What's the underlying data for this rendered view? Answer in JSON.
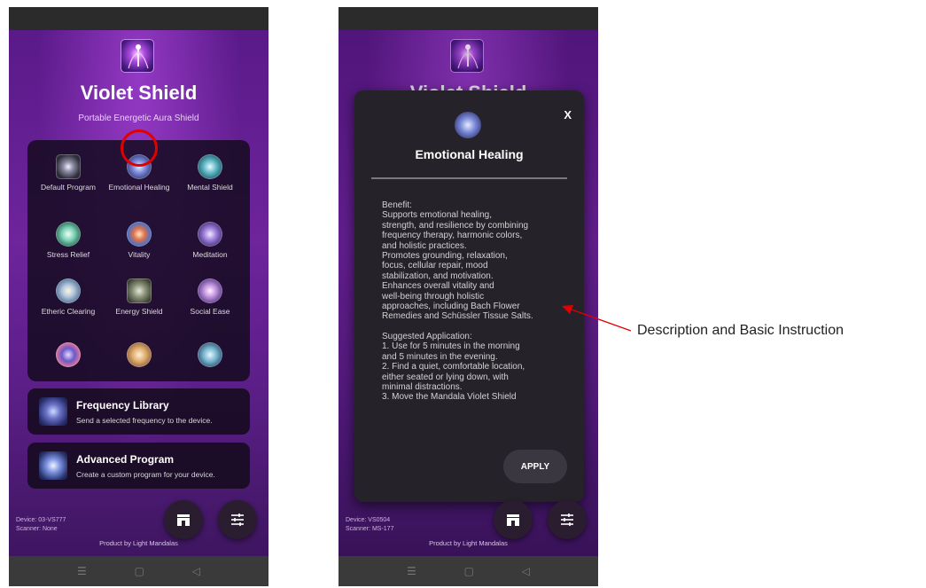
{
  "left_screen": {
    "title": "Violet Shield",
    "subtitle": "Portable Energetic Aura Shield",
    "programs": [
      {
        "label": "Default Program",
        "icon": "default-program-icon"
      },
      {
        "label": "Emotional Healing",
        "icon": "emotional-healing-icon"
      },
      {
        "label": "Mental Shield",
        "icon": "mental-shield-icon"
      },
      {
        "label": "Stress Relief",
        "icon": "stress-relief-icon"
      },
      {
        "label": "Vitality",
        "icon": "vitality-icon"
      },
      {
        "label": "Meditation",
        "icon": "meditation-icon"
      },
      {
        "label": "Etheric Clearing",
        "icon": "etheric-clearing-icon"
      },
      {
        "label": "Energy Shield",
        "icon": "energy-shield-icon"
      },
      {
        "label": "Social Ease",
        "icon": "social-ease-icon"
      }
    ],
    "frequency_library": {
      "title": "Frequency Library",
      "desc": "Send a selected frequency to the device."
    },
    "advanced_program": {
      "title": "Advanced Program",
      "desc": "Create a custom program for your device."
    },
    "device": "Device: 03-VS777",
    "scanner": "Scanner: None",
    "credit": "Product by Light Mandalas"
  },
  "right_screen": {
    "modal": {
      "close_label": "X",
      "title": "Emotional Healing",
      "body_lines": [
        "Benefit:",
        "Supports emotional healing,",
        "strength, and resilience by combining",
        "frequency therapy, harmonic colors,",
        "and holistic practices.",
        "Promotes grounding, relaxation,",
        "focus, cellular repair, mood",
        "stabilization, and motivation.",
        "Enhances overall vitality and",
        "well-being through holistic",
        "approaches, including Bach Flower",
        "Remedies and Schüssler Tissue Salts.",
        "",
        "Suggested Application:",
        "1. Use for 5 minutes in the morning",
        "and 5 minutes in the evening.",
        "2. Find a quiet, comfortable location,",
        "either seated or lying down, with",
        "minimal distractions.",
        "3. Move the Mandala Violet Shield"
      ],
      "apply_label": "APPLY"
    },
    "device": "Device: VS0504",
    "scanner": "Scanner: MS-177",
    "credit": "Product by Light Mandalas"
  },
  "annotation": {
    "label": "Description and Basic Instruction",
    "color": "#e00000"
  },
  "colors": {
    "background_purple": "#6e249c",
    "panel_dark": "#140a1e",
    "highlight": "#e00000"
  }
}
